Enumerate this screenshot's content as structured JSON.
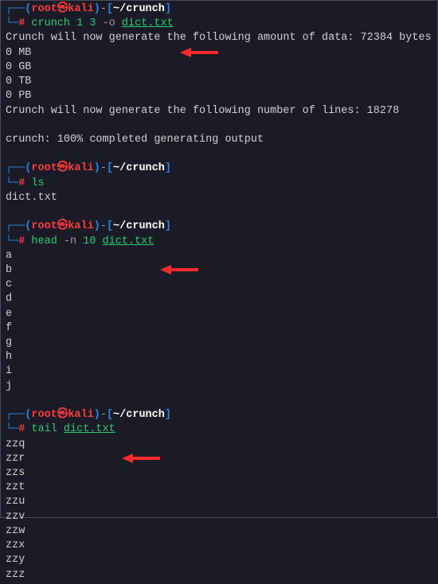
{
  "blocks": [
    {
      "prompt": {
        "user": "root",
        "host": "kali",
        "path": "~/crunch"
      },
      "command": {
        "name": "crunch",
        "pieces": [
          {
            "t": "cmd",
            "v": "crunch"
          },
          {
            "t": "arg",
            "v": "1"
          },
          {
            "t": "arg",
            "v": "3"
          },
          {
            "t": "opt",
            "v": "-o"
          },
          {
            "t": "argul",
            "v": "dict.txt"
          }
        ]
      },
      "arrow": true,
      "output": [
        "Crunch will now generate the following amount of data: 72384 bytes",
        "0 MB",
        "0 GB",
        "0 TB",
        "0 PB",
        "Crunch will now generate the following number of lines: 18278",
        "",
        "crunch: 100% completed generating output",
        ""
      ]
    },
    {
      "prompt": {
        "user": "root",
        "host": "kali",
        "path": "~/crunch"
      },
      "command": {
        "name": "ls",
        "pieces": [
          {
            "t": "cmd",
            "v": "ls"
          }
        ]
      },
      "arrow": false,
      "output": [
        "dict.txt",
        ""
      ]
    },
    {
      "prompt": {
        "user": "root",
        "host": "kali",
        "path": "~/crunch"
      },
      "command": {
        "name": "head",
        "pieces": [
          {
            "t": "cmd",
            "v": "head"
          },
          {
            "t": "opt",
            "v": "-n"
          },
          {
            "t": "arg",
            "v": "10"
          },
          {
            "t": "argul",
            "v": "dict.txt"
          }
        ]
      },
      "arrow": true,
      "output": [
        "a",
        "b",
        "c",
        "d",
        "e",
        "f",
        "g",
        "h",
        "i",
        "j",
        ""
      ]
    },
    {
      "prompt": {
        "user": "root",
        "host": "kali",
        "path": "~/crunch"
      },
      "command": {
        "name": "tail",
        "pieces": [
          {
            "t": "cmd",
            "v": "tail"
          },
          {
            "t": "argul",
            "v": "dict.txt"
          }
        ]
      },
      "arrow": true,
      "output": [
        "zzq",
        "zzr",
        "zzs",
        "zzt",
        "zzu",
        "zzv",
        "zzw",
        "zzx",
        "zzy",
        "zzz"
      ]
    }
  ],
  "icons": {
    "skull": "㉿"
  },
  "arrow_color": "#ff2a2a"
}
